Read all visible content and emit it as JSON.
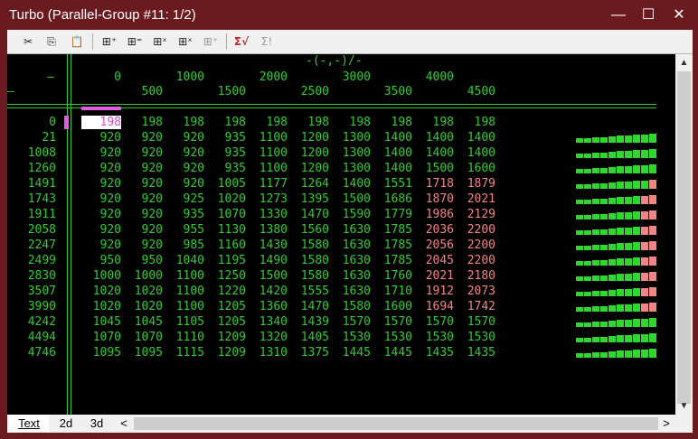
{
  "window": {
    "title": "Turbo (Parallel-Group #11: 1/2)",
    "controls": {
      "minimize": "—",
      "maximize": "☐",
      "close": "✕"
    }
  },
  "toolbar": {
    "cut_icon": "✂",
    "copy_icon": "⎘",
    "paste_icon": "📋",
    "insert_row_before": "⊞⁺",
    "insert_row_after": "⊞⁼",
    "delete_row": "⊞ˣ",
    "delete_col": "⊞ˣ",
    "insert_col": "⊞⁺",
    "sum_check": "Σ√",
    "sum_exclaim": "Σ!"
  },
  "grid": {
    "formula": "-(-,-)/-",
    "corner_top": "–",
    "corner_mid": "–",
    "col_headers_top": [
      "0",
      "1000",
      "2000",
      "3000",
      "4000"
    ],
    "col_headers_bottom": [
      "500",
      "1500",
      "2500",
      "3500",
      "4500"
    ],
    "rows": [
      {
        "label": "0",
        "values": [
          "198",
          "198",
          "198",
          "198",
          "198",
          "198",
          "198",
          "198",
          "198",
          "198"
        ]
      },
      {
        "label": "21",
        "values": [
          "920",
          "920",
          "920",
          "935",
          "1100",
          "1200",
          "1300",
          "1400",
          "1400",
          "1400"
        ]
      },
      {
        "label": "1008",
        "values": [
          "920",
          "920",
          "920",
          "935",
          "1100",
          "1200",
          "1300",
          "1400",
          "1400",
          "1400"
        ]
      },
      {
        "label": "1260",
        "values": [
          "920",
          "920",
          "920",
          "935",
          "1100",
          "1200",
          "1300",
          "1400",
          "1500",
          "1600"
        ]
      },
      {
        "label": "1491",
        "values": [
          "920",
          "920",
          "920",
          "1005",
          "1177",
          "1264",
          "1400",
          "1551",
          "1718",
          "1879"
        ]
      },
      {
        "label": "1743",
        "values": [
          "920",
          "920",
          "925",
          "1020",
          "1273",
          "1395",
          "1500",
          "1686",
          "1870",
          "2021"
        ]
      },
      {
        "label": "1911",
        "values": [
          "920",
          "920",
          "935",
          "1070",
          "1330",
          "1470",
          "1590",
          "1779",
          "1986",
          "2129"
        ]
      },
      {
        "label": "2058",
        "values": [
          "920",
          "920",
          "955",
          "1130",
          "1380",
          "1560",
          "1630",
          "1785",
          "2036",
          "2200"
        ]
      },
      {
        "label": "2247",
        "values": [
          "920",
          "920",
          "985",
          "1160",
          "1430",
          "1580",
          "1630",
          "1785",
          "2056",
          "2200"
        ]
      },
      {
        "label": "2499",
        "values": [
          "950",
          "950",
          "1040",
          "1195",
          "1490",
          "1580",
          "1630",
          "1785",
          "2045",
          "2200"
        ]
      },
      {
        "label": "2830",
        "values": [
          "1000",
          "1000",
          "1100",
          "1250",
          "1500",
          "1580",
          "1630",
          "1760",
          "2021",
          "2180"
        ]
      },
      {
        "label": "3507",
        "values": [
          "1020",
          "1020",
          "1100",
          "1220",
          "1420",
          "1555",
          "1630",
          "1710",
          "1912",
          "2073"
        ]
      },
      {
        "label": "3990",
        "values": [
          "1020",
          "1020",
          "1100",
          "1205",
          "1360",
          "1470",
          "1580",
          "1600",
          "1694",
          "1742"
        ]
      },
      {
        "label": "4242",
        "values": [
          "1045",
          "1045",
          "1105",
          "1205",
          "1340",
          "1439",
          "1570",
          "1570",
          "1570",
          "1570"
        ]
      },
      {
        "label": "4494",
        "values": [
          "1070",
          "1070",
          "1110",
          "1209",
          "1320",
          "1405",
          "1530",
          "1530",
          "1530",
          "1530"
        ]
      },
      {
        "label": "4746",
        "values": [
          "1095",
          "1095",
          "1115",
          "1209",
          "1310",
          "1375",
          "1445",
          "1445",
          "1435",
          "1435"
        ]
      }
    ],
    "red_cells": [
      [
        4,
        8
      ],
      [
        4,
        9
      ],
      [
        5,
        8
      ],
      [
        5,
        9
      ],
      [
        6,
        8
      ],
      [
        6,
        9
      ],
      [
        7,
        8
      ],
      [
        7,
        9
      ],
      [
        8,
        8
      ],
      [
        8,
        9
      ],
      [
        9,
        8
      ],
      [
        9,
        9
      ],
      [
        10,
        8
      ],
      [
        10,
        9
      ],
      [
        11,
        8
      ],
      [
        11,
        9
      ],
      [
        12,
        8
      ],
      [
        12,
        9
      ]
    ],
    "selected_cell": [
      0,
      0
    ],
    "bar_red_counts": [
      0,
      0,
      0,
      0,
      1,
      2,
      2,
      2,
      2,
      2,
      2,
      2,
      2,
      0,
      0,
      0
    ]
  },
  "tabs": [
    {
      "label": "Text",
      "active": true
    },
    {
      "label": "2d",
      "active": false
    },
    {
      "label": "3d",
      "active": false
    }
  ],
  "scroll": {
    "up": "▲",
    "down": "▼",
    "left": "<",
    "right": ">"
  },
  "colors": {
    "accent_green": "#34c934",
    "warn_red": "#f08585",
    "select_magenta": "#e35be3"
  }
}
